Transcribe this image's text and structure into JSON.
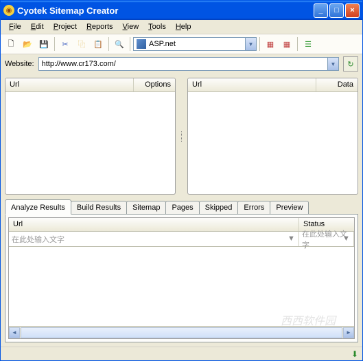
{
  "title": "Cyotek Sitemap Creator",
  "menus": [
    "File",
    "Edit",
    "Project",
    "Reports",
    "View",
    "Tools",
    "Help"
  ],
  "toolbar_combo": "ASP.net",
  "website_label": "Website:",
  "website_url": "http://www.cr173.com/",
  "left_panel": {
    "col1": "Url",
    "col2": "Options"
  },
  "right_panel": {
    "col1": "Url",
    "col2": "Data"
  },
  "tabs": [
    "Analyze Results",
    "Build Results",
    "Sitemap",
    "Pages",
    "Skipped",
    "Errors",
    "Preview"
  ],
  "grid": {
    "col1": "Url",
    "col2": "Status",
    "filter_placeholder": "在此处输入文字"
  },
  "watermark": "西西软件园"
}
